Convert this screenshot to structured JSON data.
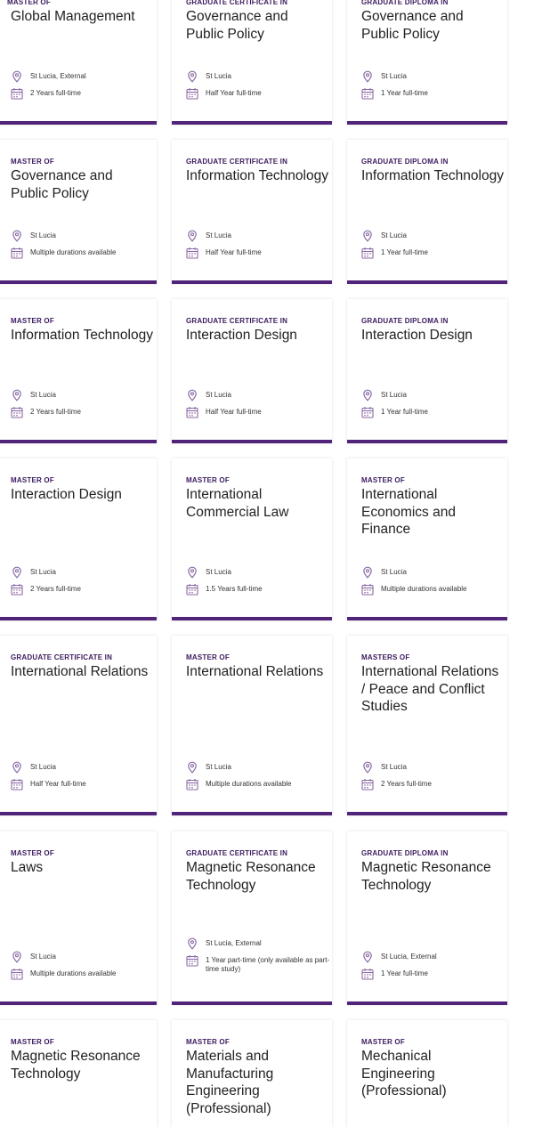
{
  "accent_color": "#51247a",
  "icon_color": "#8a6aa6",
  "location_icon": "map-pin-icon",
  "duration_icon": "calendar-icon",
  "cards": [
    {
      "type": "Master of",
      "title": "Global Management",
      "location": "St Lucia, External",
      "duration": "2 Years full-time"
    },
    {
      "type": "Graduate Certificate in",
      "title": "Governance and Public Policy",
      "location": "St Lucia",
      "duration": "Half Year full-time"
    },
    {
      "type": "Graduate Diploma in",
      "title": "Governance and Public Policy",
      "location": "St Lucia",
      "duration": "1 Year full-time"
    },
    {
      "type": "Master of",
      "title": "Governance and Public Policy",
      "location": "St Lucia",
      "duration": "Multiple durations available"
    },
    {
      "type": "Graduate Certificate in",
      "title": "Information Technology",
      "location": "St Lucia",
      "duration": "Half Year full-time"
    },
    {
      "type": "Graduate Diploma in",
      "title": "Information Technology",
      "location": "St Lucia",
      "duration": "1 Year full-time"
    },
    {
      "type": "Master of",
      "title": "Information Technology",
      "location": "St Lucia",
      "duration": "2 Years full-time"
    },
    {
      "type": "Graduate Certificate in",
      "title": "Interaction Design",
      "location": "St Lucia",
      "duration": "Half Year full-time"
    },
    {
      "type": "Graduate Diploma in",
      "title": "Interaction Design",
      "location": "St Lucia",
      "duration": "1 Year full-time"
    },
    {
      "type": "Master of",
      "title": "Interaction Design",
      "location": "St Lucia",
      "duration": "2 Years full-time"
    },
    {
      "type": "Master of",
      "title": "International Commercial Law",
      "location": "St Lucia",
      "duration": "1.5 Years full-time"
    },
    {
      "type": "Master of",
      "title": "International Economics and Finance",
      "location": "St Lucia",
      "duration": "Multiple durations available"
    },
    {
      "type": "Graduate Certificate in",
      "title": "International Relations",
      "location": "St Lucia",
      "duration": "Half Year full-time"
    },
    {
      "type": "Master of",
      "title": "International Relations",
      "location": "St Lucia",
      "duration": "Multiple durations available"
    },
    {
      "type": "Masters of",
      "title": "International Relations / Peace and Conflict Studies",
      "location": "St Lucia",
      "duration": "2 Years full-time"
    },
    {
      "type": "Master of",
      "title": "Laws",
      "location": "St Lucia",
      "duration": "Multiple durations available"
    },
    {
      "type": "Graduate Certificate in",
      "title": "Magnetic Resonance Technology",
      "location": "St Lucia, External",
      "duration": "1 Year part-time (only available as part-time study)"
    },
    {
      "type": "Graduate Diploma in",
      "title": "Magnetic Resonance Technology",
      "location": "St Lucia, External",
      "duration": "1 Year full-time"
    },
    {
      "type": "Master of",
      "title": "Magnetic Resonance Technology"
    },
    {
      "type": "Master of",
      "title": "Materials and Manufacturing Engineering (Professional)"
    },
    {
      "type": "Master of",
      "title": "Mechanical Engineering (Professional)"
    }
  ]
}
